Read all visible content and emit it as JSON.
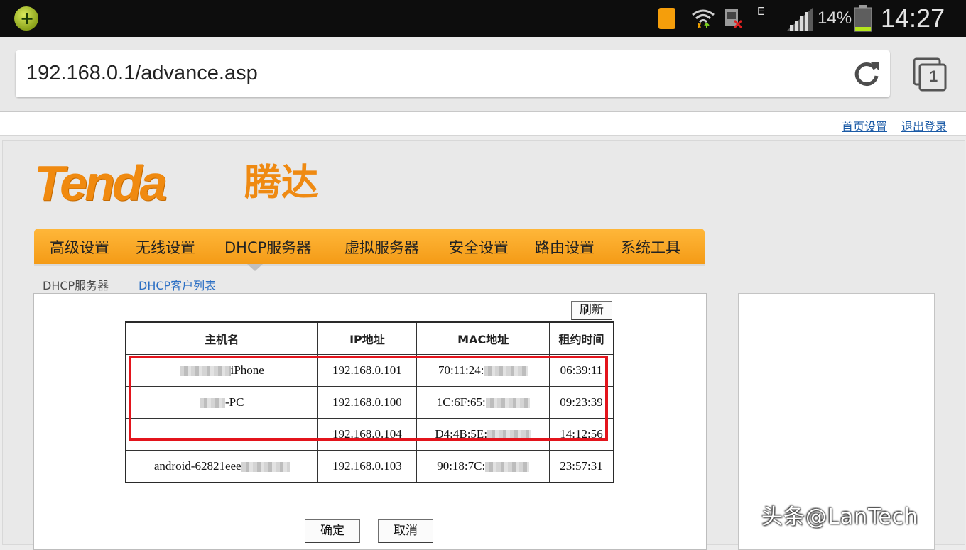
{
  "status_bar": {
    "network_type": "E",
    "battery_percent": "14%",
    "time": "14:27",
    "icons": [
      "app-badge-icon",
      "sim-icon",
      "wifi-icon",
      "no-sd-icon",
      "signal-icon",
      "battery-icon"
    ]
  },
  "browser": {
    "url": "192.168.0.1/advance.asp",
    "tab_count": "1"
  },
  "top_links": {
    "home_settings": "首页设置",
    "logout": "退出登录"
  },
  "brand": {
    "logo_en": "Tenda",
    "logo_cn": "腾达",
    "color": "#f08a10"
  },
  "menu": {
    "items": [
      {
        "label": "高级设置"
      },
      {
        "label": "无线设置"
      },
      {
        "label": "DHCP服务器"
      },
      {
        "label": "虚拟服务器"
      },
      {
        "label": "安全设置"
      },
      {
        "label": "路由设置"
      },
      {
        "label": "系统工具"
      }
    ],
    "active": "DHCP服务器"
  },
  "subtabs": {
    "dhcp_server": "DHCP服务器",
    "client_list": "DHCP客户列表"
  },
  "table": {
    "refresh_label": "刷新",
    "headers": {
      "hostname": "主机名",
      "ip": "IP地址",
      "mac": "MAC地址",
      "lease": "租约时间"
    },
    "rows": [
      {
        "hostname": "iPhone",
        "ip": "192.168.0.101",
        "mac": "70:11:24:",
        "lease": "06:39:11"
      },
      {
        "hostname": "-PC",
        "ip": "192.168.0.100",
        "mac": "1C:6F:65:",
        "lease": "09:23:39"
      },
      {
        "hostname": "",
        "ip": "192.168.0.104",
        "mac": "D4:4B:5E:",
        "lease": "14:12:56"
      },
      {
        "hostname": "android-62821eee",
        "ip": "192.168.0.103",
        "mac": "90:18:7C:",
        "lease": "23:57:31"
      }
    ],
    "highlight_color": "#e3141c"
  },
  "buttons": {
    "ok": "确定",
    "cancel": "取消"
  },
  "watermark": "头条@LanTech"
}
